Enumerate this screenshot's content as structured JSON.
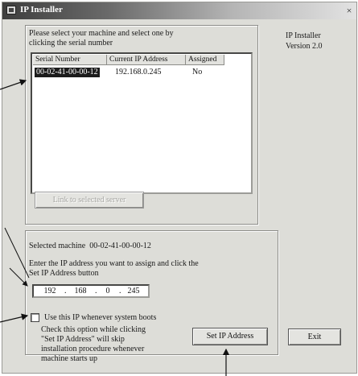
{
  "window": {
    "title": "IP Installer",
    "close_glyph": "×"
  },
  "instructions": "Please select your machine and select one by clicking the serial number",
  "side_info": {
    "app_name": "IP Installer",
    "version": "Version 2.0"
  },
  "table": {
    "columns": [
      "Serial Number",
      "Current IP Address",
      "Assigned"
    ],
    "rows": [
      {
        "serial": "00-02-41-00-00-12",
        "ip": "192.168.0.245",
        "assigned": "No"
      }
    ]
  },
  "link_button": "Link to selected server",
  "selected": {
    "label": "Selected machine",
    "value": "00-02-41-00-00-12"
  },
  "enter_ip_text": "Enter the IP address you want to assign and click the Set IP Address button",
  "ip_octets": [
    "192",
    "168",
    "0",
    "245"
  ],
  "checkbox": {
    "label": "Use this IP whenever system boots",
    "checked": false
  },
  "checkbox_help": "Check this option while clicking \"Set IP Address\" will skip installation procedure whenever machine starts up",
  "set_ip_button": "Set IP Address",
  "exit_button": "Exit"
}
